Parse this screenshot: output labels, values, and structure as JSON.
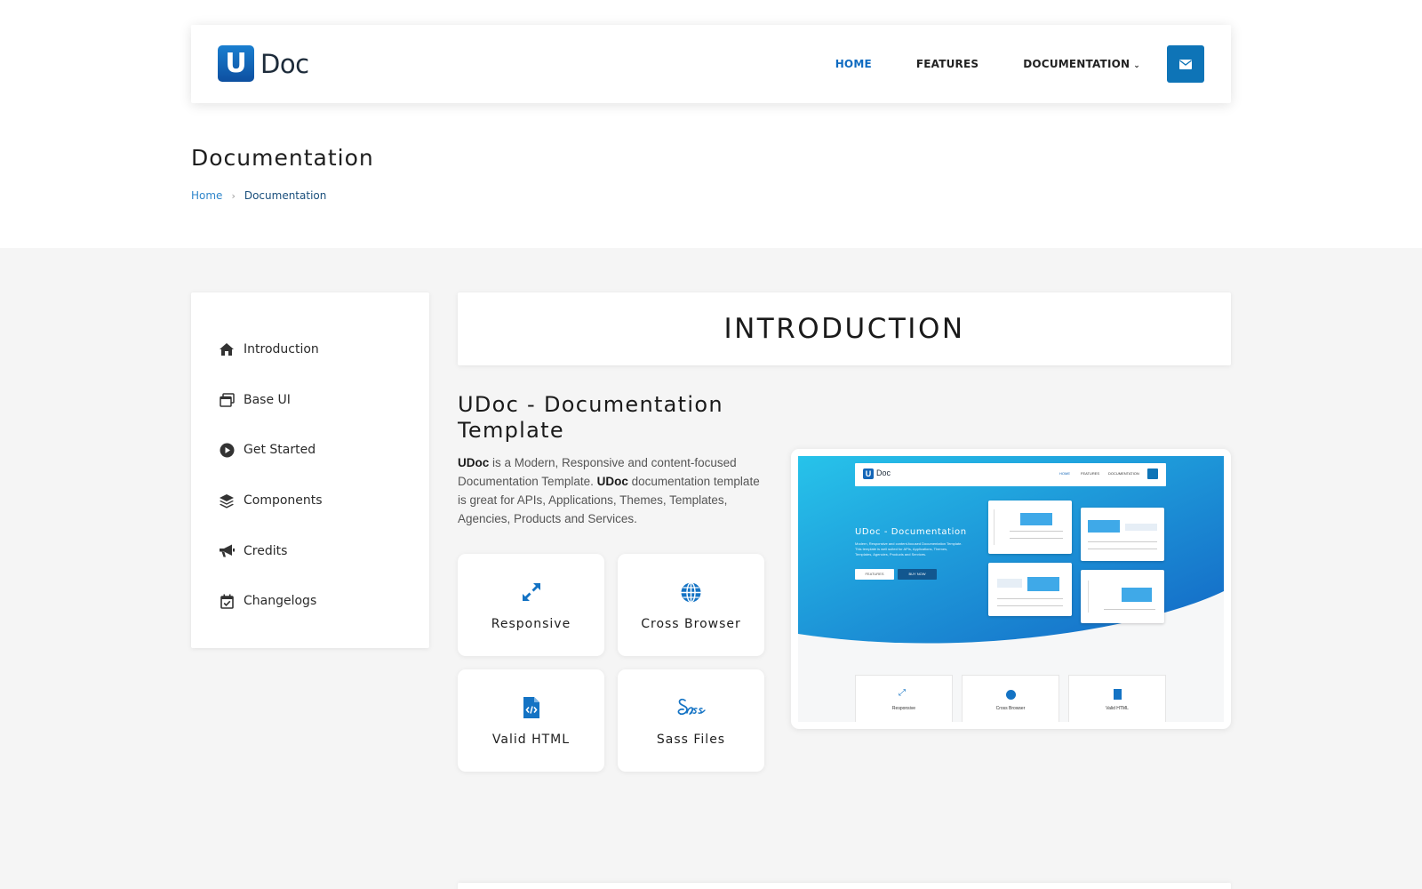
{
  "header": {
    "logo_mark": "U",
    "logo_text": "Doc",
    "nav": [
      {
        "label": "HOME",
        "active": true
      },
      {
        "label": "FEATURES",
        "active": false
      },
      {
        "label": "DOCUMENTATION",
        "active": false
      }
    ]
  },
  "page": {
    "title": "Documentation",
    "breadcrumb": [
      "Home",
      "Documentation"
    ]
  },
  "sidebar": {
    "items": [
      {
        "label": "Introduction",
        "icon": "home-icon"
      },
      {
        "label": "Base UI",
        "icon": "windows-icon"
      },
      {
        "label": "Get Started",
        "icon": "play-circle-icon"
      },
      {
        "label": "Components",
        "icon": "layers-icon"
      },
      {
        "label": "Credits",
        "icon": "megaphone-icon"
      },
      {
        "label": "Changelogs",
        "icon": "calendar-check-icon"
      }
    ]
  },
  "main": {
    "section_title": "INTRODUCTION",
    "product_title": "UDoc - Documentation Template",
    "desc": {
      "brand": "UDoc",
      "part1": " is a  Modern,  Responsive and content-focused Documentation Template. ",
      "part2": " documentation template is great for APIs, Applications, Themes, Templates, Agencies,  Products and Services."
    },
    "features": [
      {
        "label": "Responsive",
        "icon": "expand-arrows-icon"
      },
      {
        "label": "Cross Browser",
        "icon": "globe-icon"
      },
      {
        "label": "Valid HTML",
        "icon": "html-file-icon"
      },
      {
        "label": "Sass Files",
        "icon": "sass-icon"
      }
    ]
  },
  "preview": {
    "logo_mark": "U",
    "logo_text": "Doc",
    "nav": [
      "HOME",
      "FEATURES",
      "DOCUMENTATION"
    ],
    "hero_title": "UDoc - Documentation",
    "hero_desc": [
      "Modern, Responsive and content-focused Documentation Template.",
      "This template is well suited for APIs, Applications, Themes,",
      "Templates, Agencies, Products and Services."
    ],
    "buttons": [
      "FEATURES",
      "BUY NOW"
    ],
    "features": [
      "Responsive",
      "Cross Browser",
      "Valid HTML"
    ]
  },
  "colors": {
    "brand": "#0e74b7",
    "nav_active": "#0f6bc1",
    "hero_gradient_start": "#27c3ea",
    "hero_gradient_end": "#1366c5"
  }
}
